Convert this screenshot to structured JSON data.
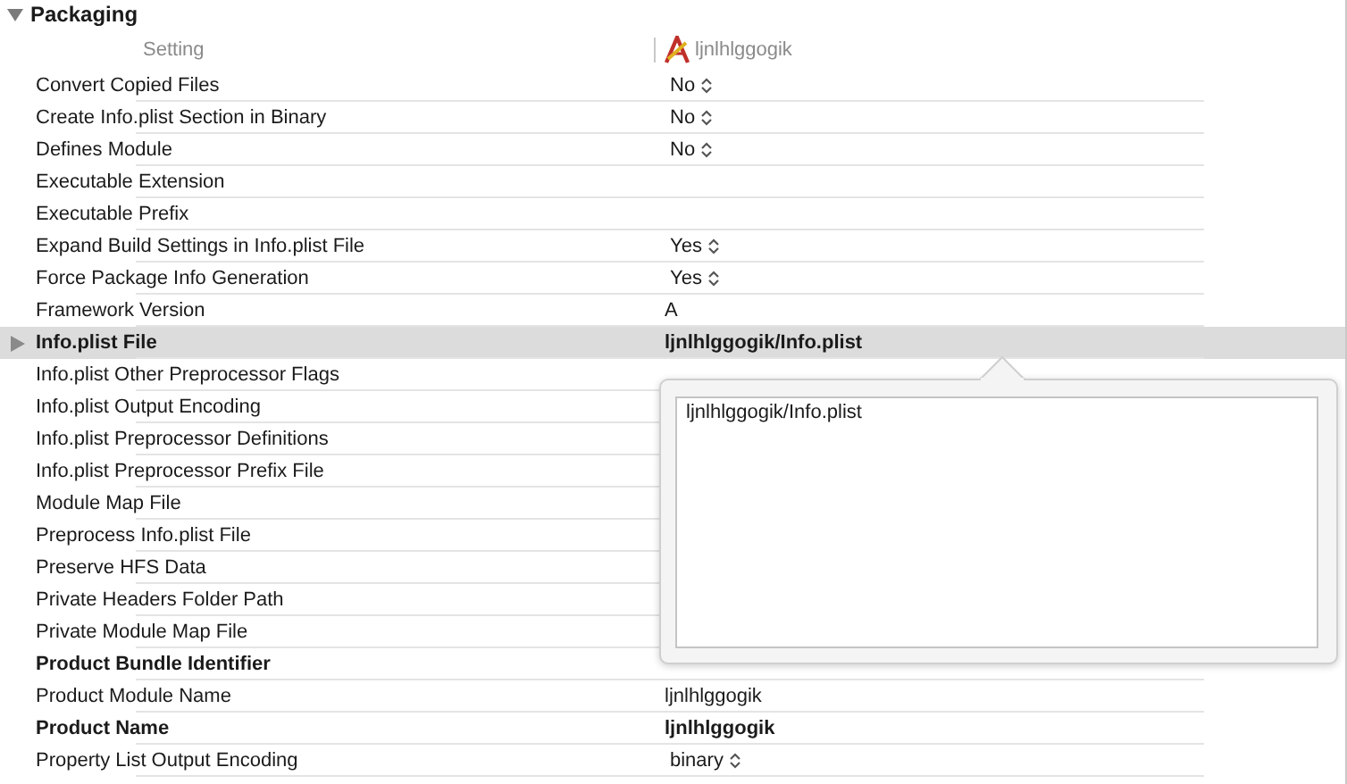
{
  "section": {
    "title": "Packaging",
    "expanded": true
  },
  "header": {
    "setting": "Setting",
    "target": "ljnlhlggogik"
  },
  "rows": [
    {
      "label": "Convert Copied Files",
      "bold": false,
      "value": "No",
      "kind": "popup",
      "selected": false
    },
    {
      "label": "Create Info.plist Section in Binary",
      "bold": false,
      "value": "No",
      "kind": "popup",
      "selected": false
    },
    {
      "label": "Defines Module",
      "bold": false,
      "value": "No",
      "kind": "popup",
      "selected": false
    },
    {
      "label": "Executable Extension",
      "bold": false,
      "selected": false
    },
    {
      "label": "Executable Prefix",
      "bold": false,
      "selected": false
    },
    {
      "label": "Expand Build Settings in Info.plist File",
      "bold": false,
      "value": "Yes",
      "kind": "popup",
      "selected": false
    },
    {
      "label": "Force Package Info Generation",
      "bold": false,
      "value": "Yes",
      "kind": "popup",
      "selected": false
    },
    {
      "label": "Framework Version",
      "bold": false,
      "value": "A",
      "kind": "text",
      "selected": false
    },
    {
      "label": "Info.plist File",
      "bold": true,
      "value": "ljnlhlggogik/Info.plist",
      "kind": "text",
      "selected": true,
      "expanded": false
    },
    {
      "label": "Info.plist Other Preprocessor Flags",
      "bold": false,
      "selected": false
    },
    {
      "label": "Info.plist Output Encoding",
      "bold": false,
      "selected": false
    },
    {
      "label": "Info.plist Preprocessor Definitions",
      "bold": false,
      "selected": false
    },
    {
      "label": "Info.plist Preprocessor Prefix File",
      "bold": false,
      "selected": false
    },
    {
      "label": "Module Map File",
      "bold": false,
      "selected": false
    },
    {
      "label": "Preprocess Info.plist File",
      "bold": false,
      "selected": false
    },
    {
      "label": "Preserve HFS Data",
      "bold": false,
      "selected": false
    },
    {
      "label": "Private Headers Folder Path",
      "bold": false,
      "selected": false
    },
    {
      "label": "Private Module Map File",
      "bold": false,
      "selected": false
    },
    {
      "label": "Product Bundle Identifier",
      "bold": true,
      "selected": false
    },
    {
      "label": "Product Module Name",
      "bold": false,
      "value": "ljnlhlggogik",
      "kind": "text",
      "selected": false
    },
    {
      "label": "Product Name",
      "bold": true,
      "value": "ljnlhlggogik",
      "kind": "text",
      "selected": false
    },
    {
      "label": "Property List Output Encoding",
      "bold": false,
      "value": "binary",
      "kind": "popup",
      "selected": false
    }
  ],
  "popover": {
    "value": "ljnlhlggogik/Info.plist"
  }
}
